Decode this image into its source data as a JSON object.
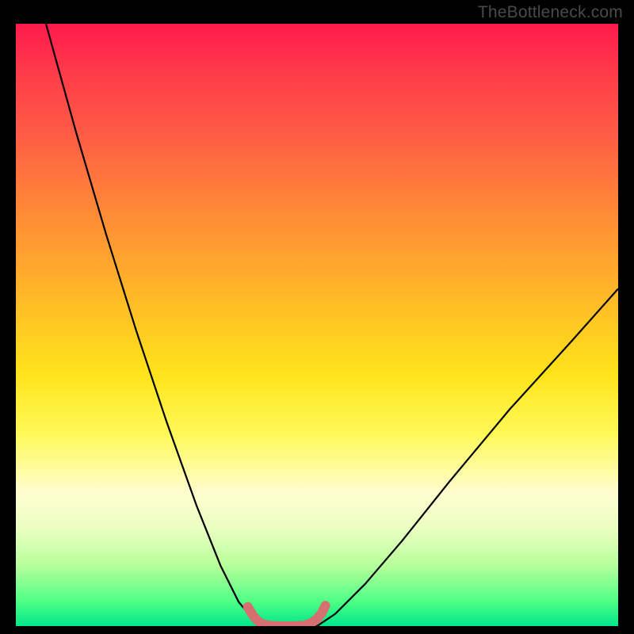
{
  "watermark": {
    "text": "TheBottleneck.com"
  },
  "chart_data": {
    "type": "line",
    "title": "",
    "xlabel": "",
    "ylabel": "",
    "xlim": [
      0,
      100
    ],
    "ylim": [
      0,
      100
    ],
    "grid": false,
    "legend": false,
    "series": [
      {
        "name": "left-curve",
        "stroke": "#000000",
        "x": [
          5,
          10,
          15,
          20,
          25,
          30,
          34,
          37,
          39.5,
          41
        ],
        "y": [
          100,
          82,
          65,
          49,
          34,
          20,
          10,
          4,
          1,
          0
        ]
      },
      {
        "name": "bottom-flat",
        "stroke": "#000000",
        "x": [
          41,
          43,
          45,
          47,
          49,
          50
        ],
        "y": [
          0,
          0,
          0,
          0,
          0,
          0
        ]
      },
      {
        "name": "right-curve",
        "stroke": "#000000",
        "x": [
          50,
          53,
          58,
          64,
          72,
          82,
          92,
          100
        ],
        "y": [
          0,
          2,
          7,
          14,
          24,
          36,
          47,
          56
        ]
      }
    ],
    "annotations": [
      {
        "name": "marker-segment",
        "stroke": "#d66f6f",
        "width": 12,
        "x": [
          38.5,
          39.2,
          40.0,
          40.8,
          42.0,
          44.0,
          46.0,
          48.0,
          49.2,
          50.0,
          50.8,
          51.4
        ],
        "y": [
          3.2,
          2.0,
          1.0,
          0.4,
          0.1,
          0.0,
          0.0,
          0.1,
          0.6,
          1.2,
          2.2,
          3.4
        ]
      }
    ],
    "background_gradient_stops": [
      {
        "pos": 0.0,
        "color": "#ff1a4d"
      },
      {
        "pos": 0.5,
        "color": "#ffe31a"
      },
      {
        "pos": 0.8,
        "color": "#fffdd0"
      },
      {
        "pos": 1.0,
        "color": "#00e68a"
      }
    ]
  }
}
